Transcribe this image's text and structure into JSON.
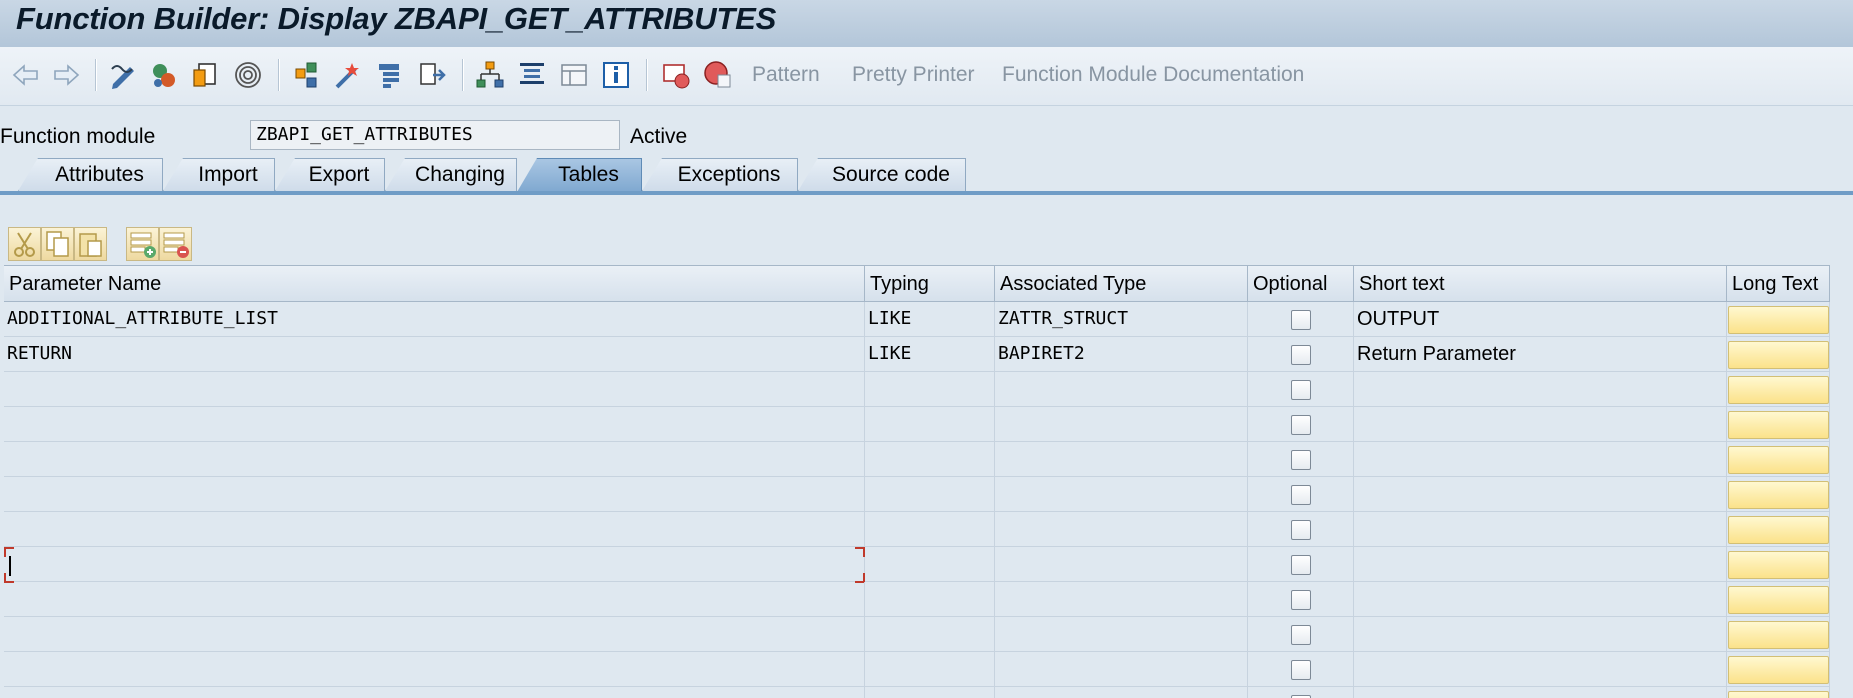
{
  "window": {
    "title": "Function Builder: Display ZBAPI_GET_ATTRIBUTES"
  },
  "toolbar": {
    "icons": [
      "back-arrow-icon",
      "forward-arrow-icon",
      "display-change-icon",
      "other-object-icon",
      "check-icon",
      "activate-icon",
      "test-direct-icon",
      "where-used-icon",
      "display-object-list-icon",
      "navigation-window-icon",
      "hierarchy-icon",
      "indent-icon",
      "frame-icon",
      "info-icon",
      "breakpoint-icon",
      "stop-icon"
    ],
    "pattern_label": "Pattern",
    "pretty_printer_label": "Pretty Printer",
    "documentation_label": "Function Module Documentation"
  },
  "header": {
    "function_module_label": "Function module",
    "function_module_value": "ZBAPI_GET_ATTRIBUTES",
    "status": "Active"
  },
  "tabs": [
    {
      "label": "Attributes",
      "active": false
    },
    {
      "label": "Import",
      "active": false
    },
    {
      "label": "Export",
      "active": false
    },
    {
      "label": "Changing",
      "active": false
    },
    {
      "label": "Tables",
      "active": true
    },
    {
      "label": "Exceptions",
      "active": false
    },
    {
      "label": "Source code",
      "active": false
    }
  ],
  "table_toolbar": {
    "icons": [
      "cut-icon",
      "copy-icon",
      "paste-icon",
      "insert-row-icon",
      "delete-row-icon"
    ]
  },
  "grid": {
    "columns": [
      "Parameter Name",
      "Typing",
      "Associated Type",
      "Optional",
      "Short text",
      "Long Text"
    ],
    "rows": [
      {
        "name": "ADDITIONAL_ATTRIBUTE_LIST",
        "typing": "LIKE",
        "assoc_type": "ZATTR_STRUCT",
        "optional": false,
        "short_text": "OUTPUT"
      },
      {
        "name": "RETURN",
        "typing": "LIKE",
        "assoc_type": "BAPIRET2",
        "optional": false,
        "short_text": "Return Parameter"
      },
      {
        "name": "",
        "typing": "",
        "assoc_type": "",
        "optional": false,
        "short_text": ""
      },
      {
        "name": "",
        "typing": "",
        "assoc_type": "",
        "optional": false,
        "short_text": ""
      },
      {
        "name": "",
        "typing": "",
        "assoc_type": "",
        "optional": false,
        "short_text": ""
      },
      {
        "name": "",
        "typing": "",
        "assoc_type": "",
        "optional": false,
        "short_text": ""
      },
      {
        "name": "",
        "typing": "",
        "assoc_type": "",
        "optional": false,
        "short_text": ""
      },
      {
        "name": "",
        "typing": "",
        "assoc_type": "",
        "optional": false,
        "short_text": ""
      },
      {
        "name": "",
        "typing": "",
        "assoc_type": "",
        "optional": false,
        "short_text": ""
      },
      {
        "name": "",
        "typing": "",
        "assoc_type": "",
        "optional": false,
        "short_text": ""
      },
      {
        "name": "",
        "typing": "",
        "assoc_type": "",
        "optional": false,
        "short_text": ""
      },
      {
        "name": "",
        "typing": "",
        "assoc_type": "",
        "optional": false,
        "short_text": ""
      }
    ],
    "focused_row": 7
  },
  "colors": {
    "active_tab": "#7fa8d0",
    "long_text_button": "#fbe28a",
    "focus_marker": "#c0392b"
  }
}
